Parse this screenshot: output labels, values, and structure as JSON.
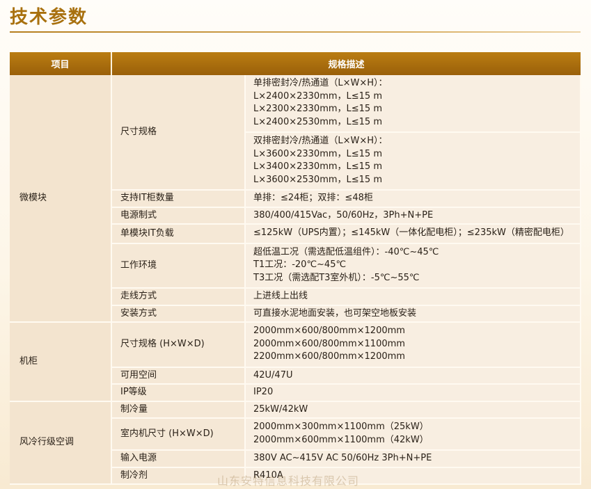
{
  "page": {
    "title": "技术参数"
  },
  "table": {
    "headers": [
      "项目",
      "规格描述"
    ],
    "groups": [
      {
        "category": "微模块",
        "rows": [
          {
            "item": "尺寸规格",
            "values": [
              [
                "单排密封冷/热通道（L×W×H）：",
                "L×2400×2330mm，L≤15 m",
                "L×2300×2330mm，L≤15 m",
                "L×2400×2530mm，L≤15 m"
              ],
              [
                "双排密封冷/热通道（L×W×H）：",
                "L×3600×2330mm，L≤15 m",
                "L×3400×2330mm，L≤15 m",
                "L×3600×2530mm，L≤15 m"
              ]
            ]
          },
          {
            "item": "支持IT柜数量",
            "values": [
              [
                "单排：≤24柜；双排：≤48柜"
              ]
            ]
          },
          {
            "item": "电源制式",
            "values": [
              [
                "380/400/415Vac，50/60Hz，3Ph+N+PE"
              ]
            ]
          },
          {
            "item": "单模块IT负载",
            "values": [
              [
                " ≤125kW（UPS内置）；≤145kW（一体化配电柜）；≤235kW（精密配电柜）"
              ]
            ]
          },
          {
            "item": "工作环境",
            "values": [
              [
                "超低温工况（需选配低温组件）：-40℃~45℃",
                "T1工况：-20℃~45℃",
                "T3工况（需选配T3室外机）：-5℃~55℃"
              ]
            ]
          },
          {
            "item": "走线方式",
            "values": [
              [
                "上进线上出线"
              ]
            ]
          },
          {
            "item": "安装方式",
            "values": [
              [
                "可直接水泥地面安装，也可架空地板安装"
              ]
            ]
          }
        ]
      },
      {
        "category": "机柜",
        "rows": [
          {
            "item": "尺寸规格 (H×W×D)",
            "values": [
              [
                "2000mm×600/800mm×1200mm",
                "2000mm×600/800mm×1100mm",
                "2200mm×600/800mm×1200mm"
              ]
            ]
          },
          {
            "item": "可用空间",
            "values": [
              [
                "42U/47U"
              ]
            ]
          },
          {
            "item": "IP等级",
            "values": [
              [
                "IP20"
              ]
            ]
          }
        ]
      },
      {
        "category": "风冷行级空调",
        "rows": [
          {
            "item": "制冷量",
            "values": [
              [
                "25kW/42kW"
              ]
            ]
          },
          {
            "item": "室内机尺寸 (H×W×D)",
            "values": [
              [
                "2000mm×300mm×1100mm（25kW）",
                "2000mm×600mm×1100mm（42kW）"
              ]
            ]
          },
          {
            "item": "输入电源",
            "values": [
              [
                "380V AC~415V AC 50/60Hz  3Ph+N+PE"
              ]
            ]
          },
          {
            "item": "制冷剂",
            "values": [
              [
                "R410A"
              ]
            ]
          }
        ]
      }
    ]
  },
  "watermark": "山东安特信息科技有限公司"
}
